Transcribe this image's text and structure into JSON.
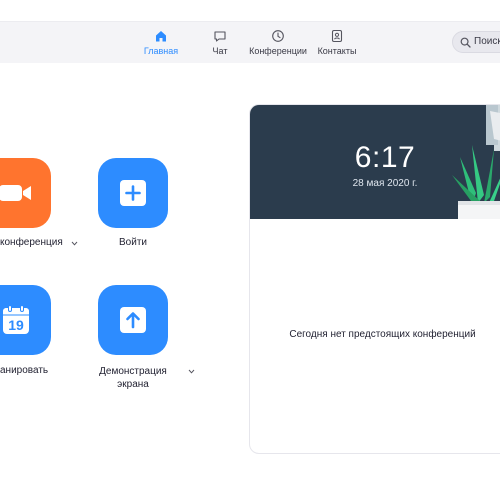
{
  "nav": {
    "tabs": [
      {
        "label": "Главная",
        "icon": "home-icon",
        "active": true
      },
      {
        "label": "Чат",
        "icon": "chat-icon",
        "active": false
      },
      {
        "label": "Конференции",
        "icon": "clock-icon",
        "active": false
      },
      {
        "label": "Контакты",
        "icon": "contacts-icon",
        "active": false
      }
    ],
    "search_text": "Поиск"
  },
  "actions": {
    "new_meeting": {
      "label": "конференция",
      "icon": "video-camera-icon",
      "color": "#ff742e"
    },
    "join": {
      "label": "Войти",
      "icon": "plus-icon",
      "color": "#2d8cff"
    },
    "schedule": {
      "label": "анировать",
      "icon": "calendar-icon",
      "day": "19",
      "color": "#2d8cff"
    },
    "share_screen": {
      "label": "Демонстрация экрана",
      "icon": "share-arrow-icon",
      "color": "#2d8cff"
    }
  },
  "card": {
    "time": "6:17",
    "date": "28 мая 2020 г.",
    "empty_message": "Сегодня нет предстоящих конференций"
  },
  "colors": {
    "accent": "#2d8cff",
    "orange": "#ff742e",
    "header_bg": "#2b3c4d"
  }
}
